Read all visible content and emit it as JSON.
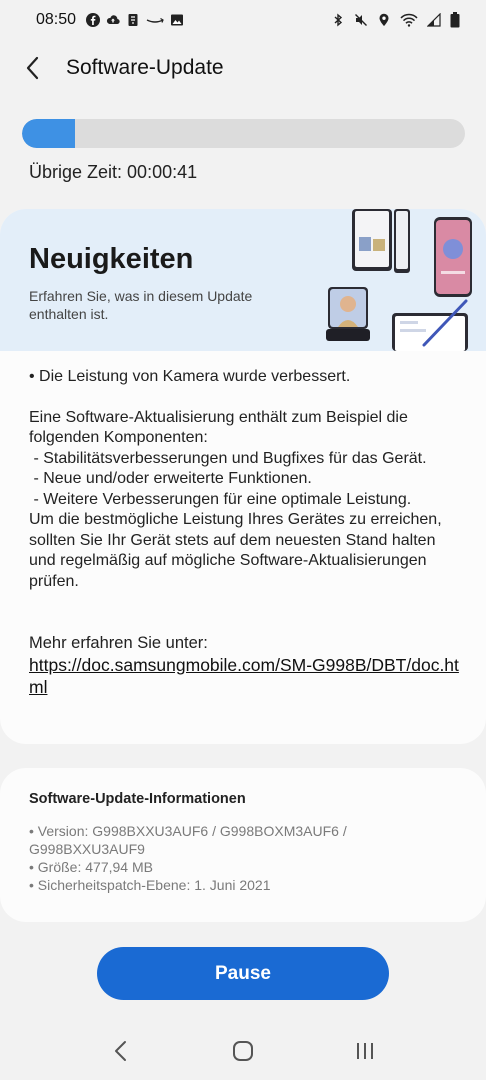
{
  "status_bar": {
    "time": "08:50",
    "left_icons": [
      "facebook-icon",
      "cloud-upload-icon",
      "usb-icon",
      "amazon-icon",
      "image-icon"
    ],
    "right_icons": [
      "bluetooth-icon",
      "mute-icon",
      "location-icon",
      "wifi-icon",
      "signal-icon",
      "battery-icon"
    ]
  },
  "header": {
    "title": "Software-Update"
  },
  "progress": {
    "fraction": 0.12,
    "color": "#3e91e4"
  },
  "remaining": {
    "label": "Übrige Zeit:",
    "value": "00:00:41"
  },
  "news": {
    "title": "Neuigkeiten",
    "subtitle": "Erfahren Sie, was in diesem Update enthalten ist.",
    "bullet": "• Die Leistung von Kamera wurde verbessert.",
    "paragraph": "Eine Software-Aktualisierung enthält zum Beispiel die folgenden Komponenten:\n - Stabilitätsverbesserungen und Bugfixes für das Gerät.\n - Neue und/oder erweiterte Funktionen.\n - Weitere Verbesserungen für eine optimale Leistung.\nUm die bestmögliche Leistung Ihres Gerätes zu erreichen, sollten Sie Ihr Gerät stets auf dem neuesten Stand halten und regelmäßig auf mögliche Software-Aktualisierungen prüfen.",
    "more_label": "Mehr erfahren Sie unter:",
    "link": "https://doc.samsungmobile.com/SM-G998B/DBT/doc.html"
  },
  "info": {
    "title": "Software-Update-Informationen",
    "version": "• Version: G998BXXU3AUF6 / G998BOXM3AUF6 / G998BXXU3AUF9",
    "size": "• Größe: 477,94 MB",
    "patch": "• Sicherheitspatch-Ebene: 1. Juni 2021"
  },
  "pause_label": "Pause",
  "nav": {
    "icons": [
      "back-icon",
      "home-icon",
      "recents-icon"
    ]
  }
}
